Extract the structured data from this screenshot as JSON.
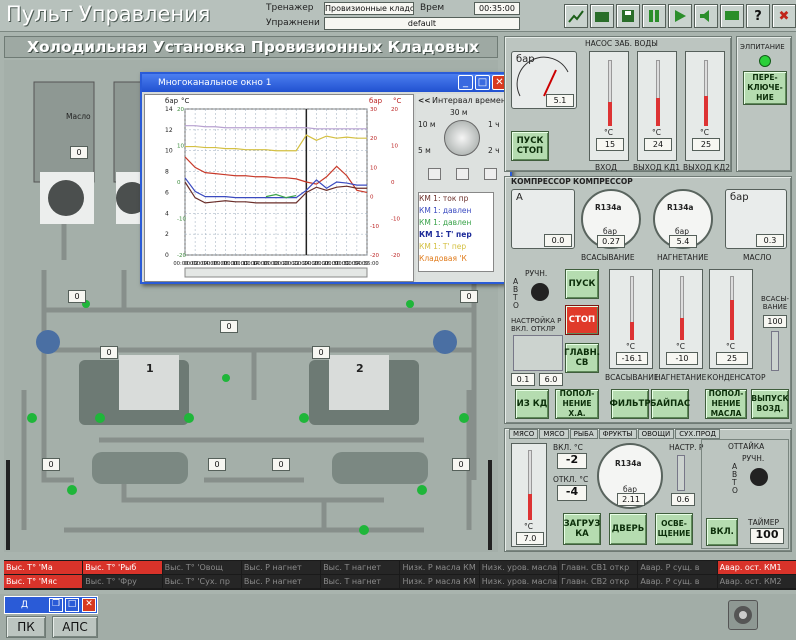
{
  "app": {
    "title": "Пульт Управления",
    "trainer_label": "Тренажер",
    "trainer_value": "Провизионные кладовые",
    "exercise_label": "Упражнени",
    "exercise_value": "default",
    "time_label": "Врем",
    "time_value": "00:35:00"
  },
  "subtitle": "Холодильная Установка Провизионных Кладовых",
  "colors": {
    "accent": "#2a5bd7",
    "alarm": "#e03a2a",
    "button": "#b5dcb0"
  },
  "toolbar": [
    {
      "icon": "chart-icon"
    },
    {
      "icon": "folder-icon"
    },
    {
      "icon": "save-icon"
    },
    {
      "icon": "pause-icon"
    },
    {
      "icon": "play-icon"
    },
    {
      "icon": "sound-icon"
    },
    {
      "icon": "message-icon"
    },
    {
      "icon": "help-icon",
      "label": "?"
    },
    {
      "icon": "exit-icon",
      "label": "✖"
    }
  ],
  "window": {
    "title": "Многоканальное окно 1",
    "interval_label": "Интервал времен",
    "dial_top": "30 м",
    "dial_labels": [
      "10 м",
      "1 ч",
      "5 м",
      "2 ч"
    ],
    "nav_arrow": "<<",
    "legend": [
      "КМ 1: ток пр",
      "КМ 1: давлен",
      "КМ 1: давлен",
      "КМ 1: Т' пер",
      "КМ 1: Т' пер",
      "Кладовая 'К"
    ],
    "units_left": [
      "бар",
      "°C"
    ],
    "units_right": [
      "бар",
      "°C"
    ]
  },
  "chart_data": {
    "type": "line",
    "x": [
      "00:00:00",
      "00:02:00",
      "00:04:00",
      "00:06:00",
      "00:08:00",
      "00:10:00",
      "00:12:00",
      "00:14:00",
      "00:16:00",
      "00:18:00",
      "00:20:00",
      "00:22:00",
      "00:24:00",
      "00:26:00",
      "00:28:00",
      "00:30:00",
      "00:32:00",
      "00:34:00",
      "00:36:00"
    ],
    "ylim": [
      0,
      14
    ],
    "y_ticks": [
      0,
      2,
      4,
      6,
      8,
      10,
      12,
      14
    ],
    "y2_ticks": [
      -20,
      -10,
      0,
      10,
      20
    ],
    "y3_ticks": [
      -20,
      -10,
      0,
      10,
      20,
      30
    ],
    "y4_ticks": [
      -20,
      -10,
      0,
      10,
      20
    ],
    "series": [
      {
        "color": "#d4c042",
        "values": [
          10.4,
          10.4,
          10.3,
          10.3,
          10.2,
          10.2,
          10.1,
          10.1,
          10.1,
          10.0,
          10.0,
          10.0,
          11.5,
          11.0,
          11.4,
          11.2,
          11.3,
          11.2,
          11.2
        ]
      },
      {
        "color": "#c83a2a",
        "values": [
          9.4,
          8.4,
          7.9,
          7.8,
          7.7,
          7.6,
          7.6,
          7.5,
          7.5,
          7.4,
          7.4,
          7.3,
          7.0,
          6.8,
          7.5,
          8.5,
          7.6,
          6.2,
          6.0
        ]
      },
      {
        "color": "#6b2f2a",
        "values": [
          7.0,
          5.5,
          5.0,
          5.1,
          5.2,
          5.1,
          5.1,
          5.0,
          5.0,
          5.0,
          5.0,
          5.0,
          6.0,
          6.5,
          6.2,
          6.5,
          6.6,
          6.4,
          6.4
        ]
      },
      {
        "color": "#3b4bc0",
        "values": [
          7.4,
          6.1,
          5.6,
          5.6,
          5.6,
          5.5,
          5.5,
          5.5,
          5.5,
          5.5,
          5.5,
          5.5,
          6.2,
          7.2,
          6.4,
          7.0,
          6.9,
          6.7,
          6.7
        ]
      },
      {
        "color": "#3aa34a",
        "values": [
          null,
          null,
          null,
          null,
          null,
          null,
          null,
          null,
          5.6,
          5.8,
          5.5,
          5.7,
          null,
          null,
          null,
          null,
          null,
          null,
          null
        ]
      },
      {
        "color": "#b7a1d0",
        "values": [
          12.4,
          12.4,
          12.3,
          12.3,
          12.2,
          12.2,
          12.2,
          12.2,
          12.2,
          12.2,
          12.2,
          12.2,
          12.2,
          12.1,
          12.1,
          12.1,
          12.1,
          12.1,
          12.1
        ]
      }
    ]
  },
  "pump": {
    "title": "НАСОС ЗАБ. ВОДЫ",
    "gauge": {
      "unit": "бар",
      "value": "5.1"
    },
    "therms": [
      {
        "unit": "°C",
        "value": "15",
        "label": "ВХОД"
      },
      {
        "unit": "°C",
        "value": "24",
        "label": "ВЫХОД КД1"
      },
      {
        "unit": "°C",
        "value": "25",
        "label": "ВЫХОД КД2"
      }
    ],
    "start_stop": "ПУСК СТОП",
    "scale_labels": [
      "50",
      "40",
      "30",
      "20",
      "10",
      "0"
    ]
  },
  "alarm_panel": {
    "title": "ЭЛПИТАНИЕ",
    "button": "ПЕРЕ- КЛЮЧЕ- НИЕ"
  },
  "compressor": {
    "title": "КОМПРЕССОР",
    "title2": "КОМПРЕССОР",
    "ammeter": {
      "unit": "A",
      "value": "0.0"
    },
    "suction": {
      "gas": "R134a",
      "unit": "бар",
      "value": "0.27",
      "label": "ВСАСЫВАНИЕ"
    },
    "discharge": {
      "gas": "R134a",
      "unit": "бар",
      "value": "5.4",
      "label": "НАГНЕТАНИЕ"
    },
    "oil": {
      "unit": "бар",
      "value": "0.3",
      "label": "МАСЛО"
    },
    "mode": {
      "label": "РУЧН.",
      "letters": [
        "A",
        "B",
        "T",
        "O"
      ]
    },
    "buttons": {
      "start": "ПУСК",
      "stop": "СТОП",
      "main": "ГЛАВН. СВ"
    },
    "setting": {
      "title": "НАСТРОЙКА Р",
      "on": "ВКЛ.",
      "off": "ОТКЛ.",
      "unit": "Р",
      "values": [
        "0.1",
        "6.0"
      ]
    },
    "therms": [
      {
        "unit": "°C",
        "value": "-16.1",
        "label": "ВСАСЫВАНИЕ"
      },
      {
        "unit": "°C",
        "value": "-10",
        "label": "НАГНЕТАНИЕ"
      },
      {
        "unit": "°C",
        "value": "25",
        "label": "КОНДЕНСАТОР"
      }
    ],
    "suction_slider": {
      "label": "ВСАСЫ- ВАНИЕ",
      "value": "100"
    }
  },
  "row_buttons": [
    "ИЗ КД",
    "ПОПОЛ- НЕНИЕ Х.А.",
    "ФИЛЬТР",
    "БАЙПАС",
    "ПОПОЛ- НЕНИЕ МАСЛА",
    "ВЫПУСК ВОЗД."
  ],
  "cold_room": {
    "tabs": [
      "МЯСО",
      "МЯСО",
      "РЫБА",
      "ФРУКТЫ",
      "ОВОЩИ",
      "СУХ.ПРОД"
    ],
    "therm": {
      "unit": "°C",
      "value": "7.0"
    },
    "on_label": "ВКЛ. °C",
    "on_value": "-2",
    "off_label": "ОТКЛ. °C",
    "off_value": "-4",
    "gauge": {
      "gas": "R134a",
      "unit": "бар",
      "value": "2.11"
    },
    "set_label": "НАСТР. Р",
    "set_value": "0.6",
    "buttons": [
      "ЗАГРУЗ КА",
      "ДВЕРЬ",
      "ОСВЕ- ЩЕНИЕ"
    ],
    "thaw": {
      "title": "ОТТАЙКА",
      "label": "РУЧН.",
      "letters": [
        "A",
        "B",
        "T",
        "O"
      ],
      "button": "ВКЛ.",
      "timer_label": "ТАЙМЕР",
      "timer_value": "100"
    }
  },
  "diagram_labels": {
    "oil_label": "Масло",
    "comp1": "1",
    "comp2": "2",
    "values": [
      "0",
      "0",
      "0",
      "0",
      "0",
      "0",
      "0",
      "0",
      "0",
      "0",
      "0"
    ]
  },
  "alarms_row1": [
    "Выс. Т° 'Ма",
    "Выс. Т° 'Рыб",
    "Выс. Т° 'Овощ",
    "Выс. Р нагнет",
    "Выс. Т нагнет",
    "Низк. Р масла КМ",
    "Низк. уров. масла КМ",
    "Главн. СВ1 откр",
    "Авар. Р сущ. в",
    "Авар. ост. КМ1"
  ],
  "alarms_row2": [
    "Выс. Т° 'Мяс",
    "Выс. Т° 'Фру",
    "Выс. Т° 'Сух. пр",
    "Выс. Р нагнет",
    "Выс. Т нагнет",
    "Низк. Р масла КМ",
    "Низк. уров. масла КМ",
    "Главн. СВ2 откр",
    "Авар. Р сущ. в",
    "Авар. ост. КМ2"
  ],
  "taskbar": {
    "mini_title": "Д",
    "buttons": [
      "ПК",
      "АПС"
    ]
  }
}
